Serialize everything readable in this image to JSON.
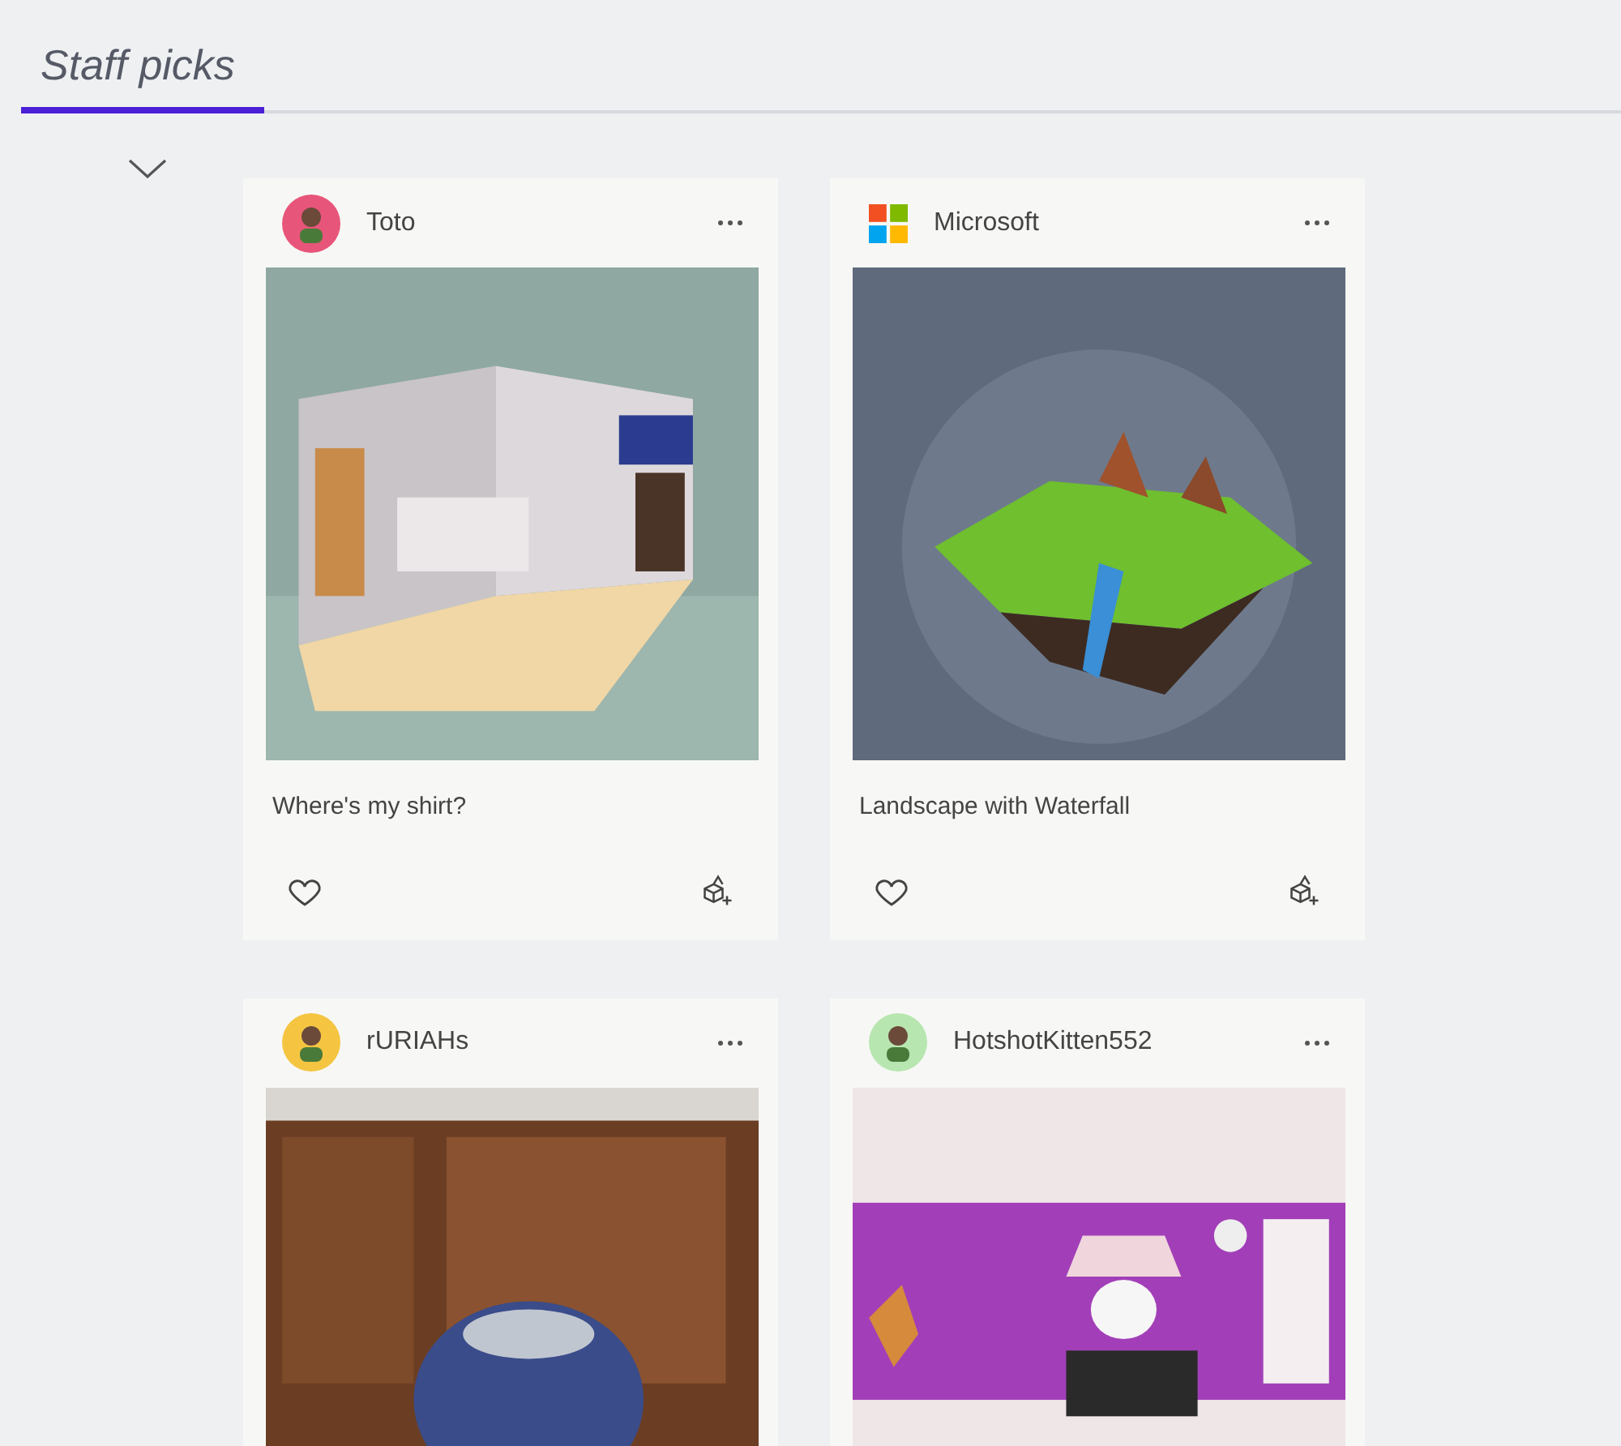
{
  "tabs": [
    {
      "label": "Staff picks",
      "selected": true
    }
  ],
  "cards": [
    {
      "author": "Toto",
      "avatar": {
        "kind": "avatar",
        "color": "#e8557a"
      },
      "title": "Where's my shirt?",
      "liked": false
    },
    {
      "author": "Microsoft",
      "avatar": {
        "kind": "logo"
      },
      "title": "Landscape with Waterfall",
      "liked": false
    },
    {
      "author": "rURIAHs",
      "avatar": {
        "kind": "avatar",
        "color": "#f5c542"
      }
    },
    {
      "author": "HotshotKitten552",
      "avatar": {
        "kind": "avatar",
        "color": "#b8e6b0"
      }
    }
  ]
}
